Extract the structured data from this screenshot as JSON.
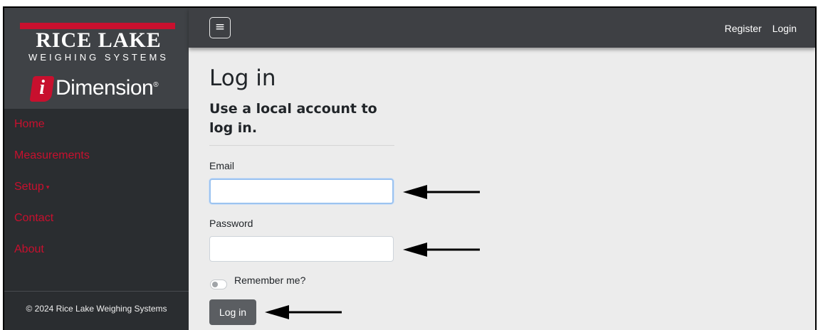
{
  "brand": {
    "company_wordmark": "RICE LAKE",
    "company_subtitle": "WEIGHING SYSTEMS",
    "product_badge_letter": "i",
    "product_name": "Dimension",
    "product_reg_mark": "®"
  },
  "sidebar": {
    "items": [
      {
        "label": "Home"
      },
      {
        "label": "Measurements"
      },
      {
        "label": "Setup"
      },
      {
        "label": "Contact"
      },
      {
        "label": "About"
      }
    ],
    "setup_caret": "▾",
    "footer": "© 2024 Rice Lake Weighing Systems",
    "accent_color": "#c8102e"
  },
  "topbar": {
    "menu_icon": "hamburger-icon",
    "menu_glyph": "≡",
    "register_label": "Register",
    "login_label": "Login"
  },
  "login_form": {
    "title": "Log in",
    "subtitle": "Use a local account to log in.",
    "email_label": "Email",
    "email_value": "",
    "password_label": "Password",
    "password_value": "",
    "remember_label": "Remember me?",
    "remember_checked": false,
    "submit_label": "Log in"
  },
  "annotations": {
    "arrow_icon": "left-arrow-icon",
    "count": 3
  }
}
